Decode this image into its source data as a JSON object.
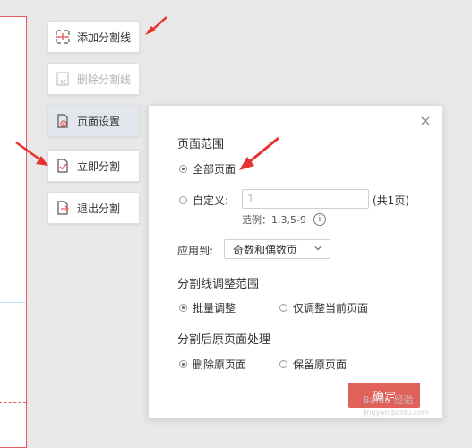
{
  "toolbar": {
    "add_line": "添加分割线",
    "delete_line": "删除分割线",
    "page_setup": "页面设置",
    "split_now": "立即分割",
    "exit_split": "退出分割"
  },
  "panel": {
    "page_range_title": "页面范围",
    "all_pages": "全部页面",
    "custom": "自定义:",
    "custom_value": "1",
    "total_pages": "(共1页)",
    "example": "范例：1,3,5-9",
    "apply_to_label": "应用到:",
    "apply_to_value": "奇数和偶数页",
    "adjust_title": "分割线调整范围",
    "batch_adjust": "批量调整",
    "only_current": "仅调整当前页面",
    "after_title": "分割后原页面处理",
    "delete_original": "删除原页面",
    "keep_original": "保留原页面",
    "ok": "确定"
  },
  "watermark": {
    "text": "Baidu 经验",
    "url": "jingyan.baidu.com"
  },
  "colors": {
    "accent": "#e0605a",
    "arrow": "#e8322d"
  }
}
